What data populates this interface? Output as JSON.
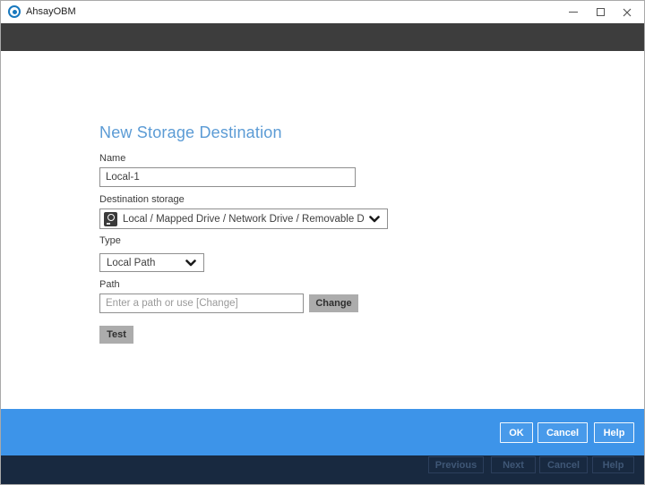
{
  "window": {
    "title": "AhsayOBM"
  },
  "page": {
    "heading": "New Storage Destination"
  },
  "form": {
    "name": {
      "label": "Name",
      "value": "Local-1"
    },
    "destination": {
      "label": "Destination storage",
      "selected_option": "Local / Mapped Drive / Network Drive / Removable Drive",
      "icon": "drive-icon"
    },
    "type": {
      "label": "Type",
      "selected_option": "Local Path"
    },
    "path": {
      "label": "Path",
      "value": "",
      "placeholder": "Enter a path or use [Change]",
      "change_button": "Change"
    },
    "test_button": "Test"
  },
  "action_bar": {
    "ok": "OK",
    "cancel": "Cancel",
    "help": "Help"
  },
  "wizard_bar": {
    "previous": "Previous",
    "next": "Next",
    "cancel": "Cancel",
    "help": "Help",
    "state": "disabled"
  },
  "colors": {
    "header_strip": "#3d3d3d",
    "heading_text": "#5b9bd5",
    "action_bar_bg": "#3d94e9",
    "wizard_bar_bg": "#182940",
    "gray_button_bg": "#acacac",
    "logo_blue": "#1878be"
  }
}
